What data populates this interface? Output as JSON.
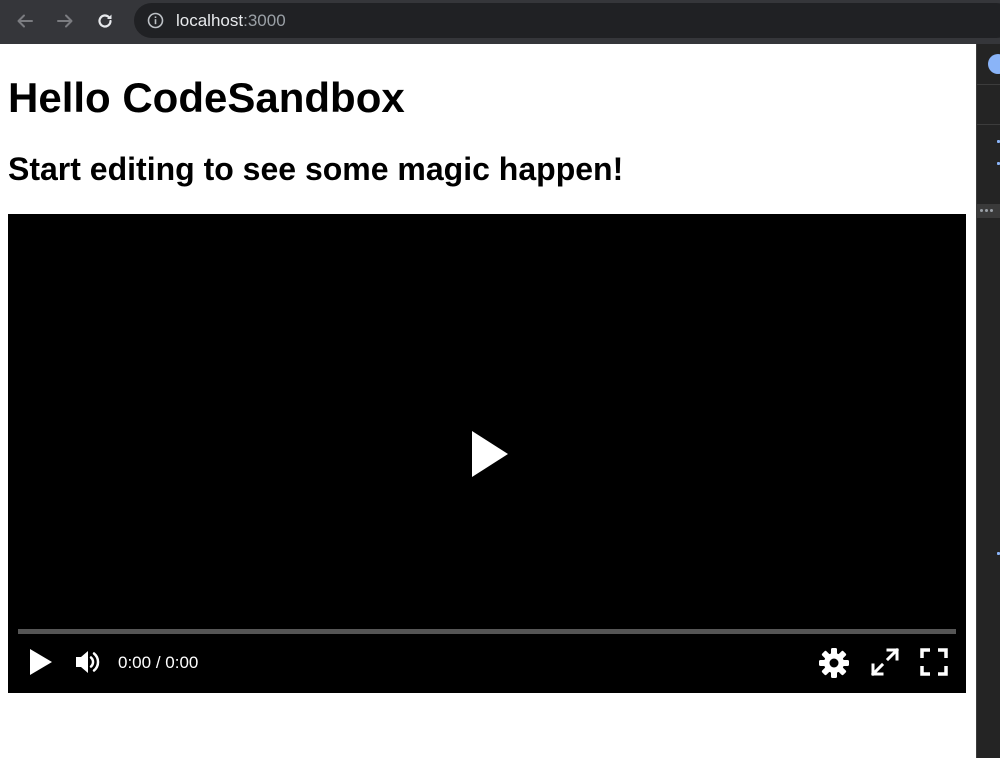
{
  "browser": {
    "address_host": "localhost",
    "address_port": ":3000",
    "icons": [
      "back-arrow-icon",
      "forward-arrow-icon",
      "reload-icon",
      "info-icon"
    ]
  },
  "page": {
    "title": "Hello CodeSandbox",
    "subtitle": "Start editing to see some magic happen!"
  },
  "player": {
    "current_time": "0:00",
    "separator": "/",
    "duration": "0:00",
    "progress": 0,
    "icons": [
      "big-play-icon",
      "play-icon",
      "volume-icon",
      "settings-icon",
      "expand-icon",
      "fullscreen-icon"
    ]
  },
  "colors": {
    "toolbar_bg": "#35363a",
    "omnibox_bg": "#202124",
    "player_bg": "#000000",
    "progress_track": "#555555",
    "control_fg": "#ffffff"
  }
}
